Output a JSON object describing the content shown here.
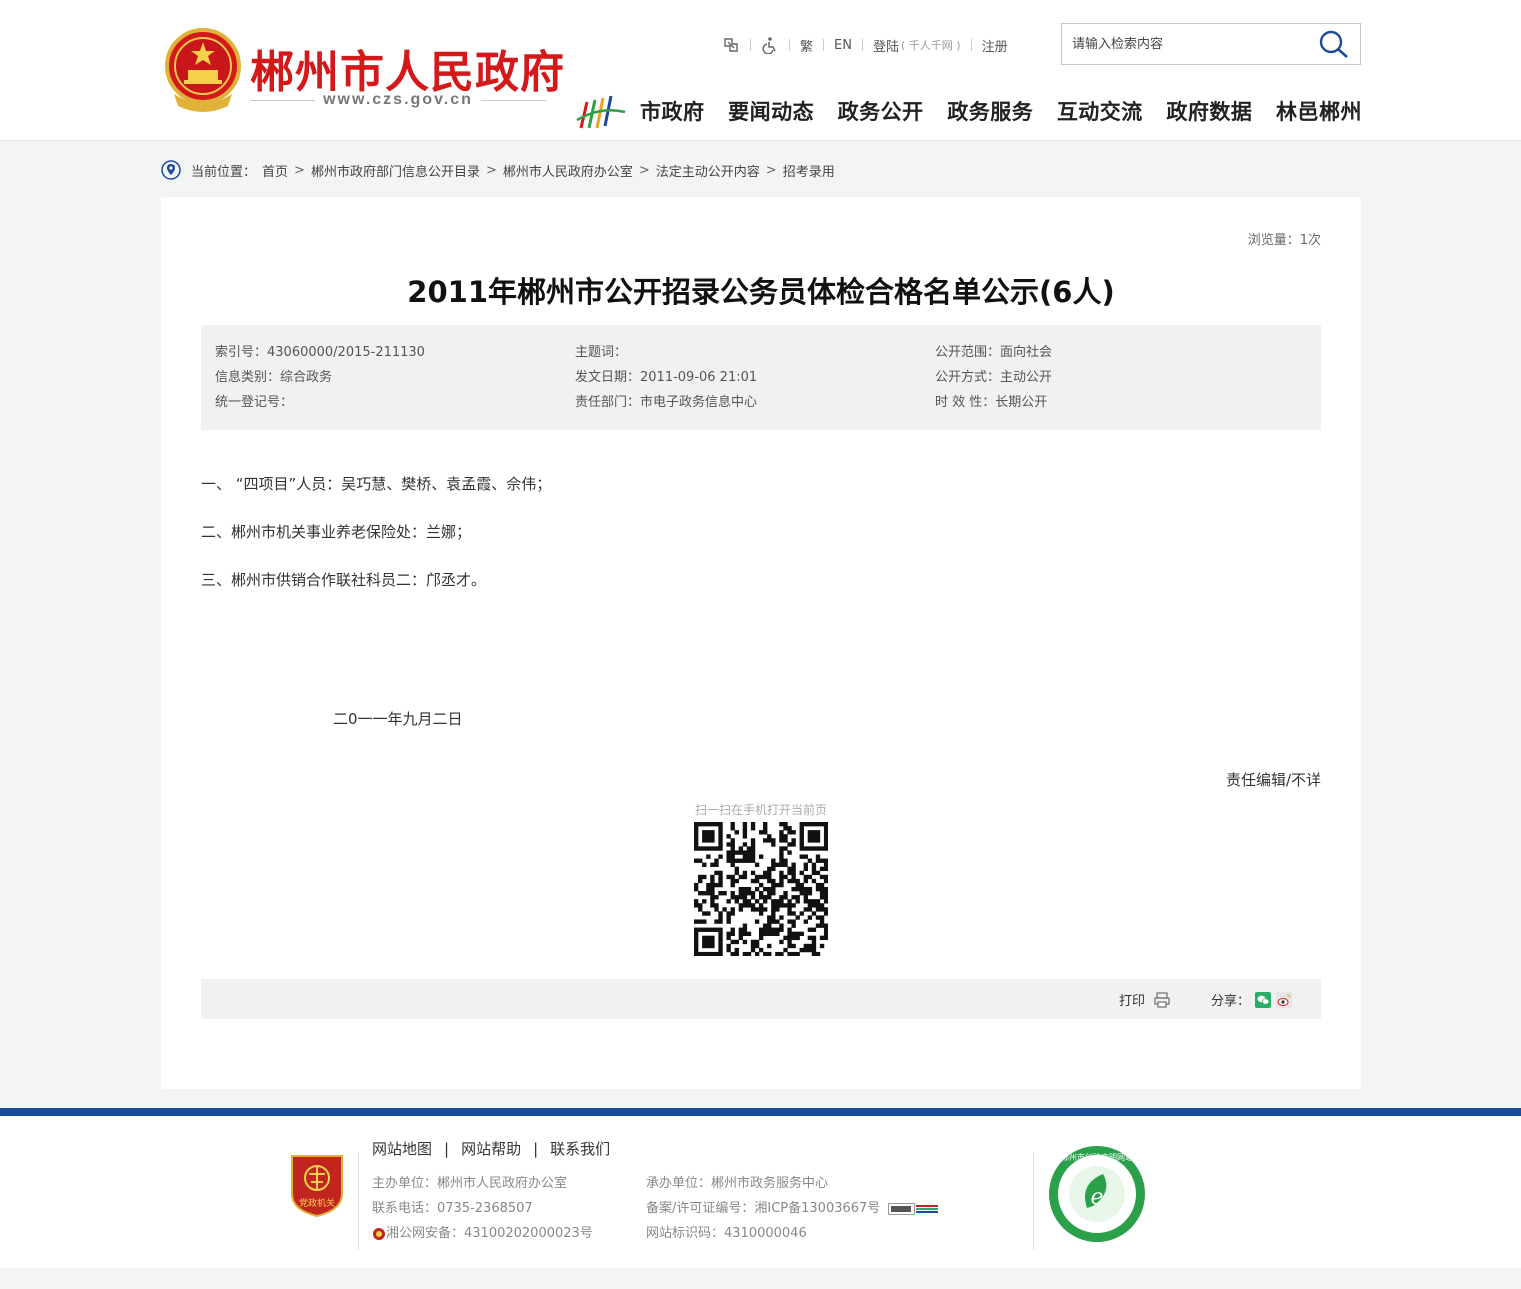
{
  "header": {
    "site_title": "郴州市人民政府",
    "site_url": "www.czs.gov.cn",
    "toplinks": {
      "traditional": "繁",
      "english": "EN",
      "login": "登陆",
      "login_note": "( 千人千网 )",
      "register": "注册"
    },
    "search_placeholder": "请输入检索内容",
    "nav": [
      "市政府",
      "要闻动态",
      "政务公开",
      "政务服务",
      "互动交流",
      "政府数据",
      "林邑郴州"
    ]
  },
  "breadcrumb": {
    "label": "当前位置：",
    "items": [
      "首页",
      "郴州市政府部门信息公开目录",
      "郴州市人民政府办公室",
      "法定主动公开内容",
      "招考录用"
    ]
  },
  "article": {
    "views": "浏览量：1次",
    "title": "2011年郴州市公开招录公务员体检合格名单公示(6人)",
    "meta": {
      "col1": [
        "索引号：43060000/2015-211130",
        "信息类别：综合政务",
        "统一登记号："
      ],
      "col2": [
        "主题词：",
        "发文日期：2011-09-06 21:01",
        "责任部门：市电子政务信息中心"
      ],
      "col3": [
        "公开范围：面向社会",
        "公开方式：主动公开",
        "时 效 性：长期公开"
      ]
    },
    "paragraphs": [
      "一、 “四项目”人员：吴巧慧、樊桥、袁孟霞、佘伟；",
      "二、郴州市机关事业养老保险处：兰娜；",
      "三、郴州市供销合作联社科员二：邝丞才。"
    ],
    "date": "二0一一年九月二日",
    "editor": "责任编辑/不详",
    "qr_caption": "扫一扫在手机打开当前页",
    "print_label": "打印",
    "share_label": "分享："
  },
  "footer": {
    "links": [
      "网站地图",
      "网站帮助",
      "联系我们"
    ],
    "left_info": [
      "主办单位：郴州市人民政府办公室",
      "联系电话：0735-2368507",
      "湘公网安备：43100202000023号"
    ],
    "right_info": [
      "承办单位：郴州市政务服务中心",
      "备案/许可证编号：湘ICP备13003667号",
      "网站标识码：4310000046"
    ],
    "badge_text": "党政机关",
    "civ_text": "郴州市创建文明网站"
  },
  "colors": {
    "brand_red": "#d4191b",
    "footer_blue": "#1a4a9a",
    "meta_bg": "#f1f1f1"
  }
}
